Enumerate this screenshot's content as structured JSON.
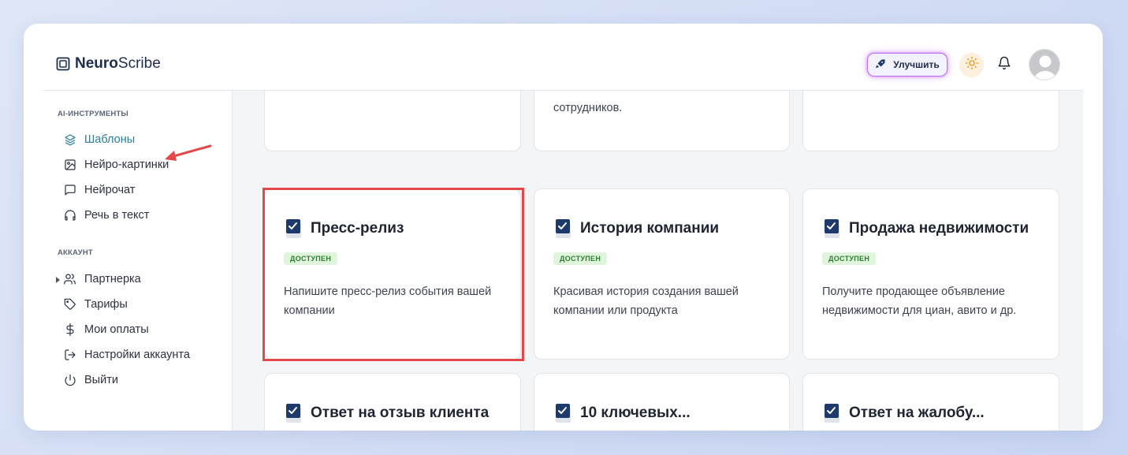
{
  "app": {
    "logo_bold": "Neuro",
    "logo_regular": "Scribe"
  },
  "header": {
    "upgrade_label": "Улучшить",
    "icons": [
      "rocket-icon",
      "sun-icon",
      "bell-icon",
      "avatar"
    ]
  },
  "sidebar": {
    "sections": [
      {
        "title": "AI-ИНСТРУМЕНТЫ",
        "items": [
          {
            "label": "Шаблоны",
            "icon": "layers-icon",
            "active": true
          },
          {
            "label": "Нейро-картинки",
            "icon": "image-icon"
          },
          {
            "label": "Нейрочат",
            "icon": "chat-icon"
          },
          {
            "label": "Речь в текст",
            "icon": "headphones-icon"
          }
        ]
      },
      {
        "title": "АККАУНТ",
        "items": [
          {
            "label": "Партнерка",
            "icon": "users-icon",
            "expandable": true
          },
          {
            "label": "Тарифы",
            "icon": "tag-icon"
          },
          {
            "label": "Мои оплаты",
            "icon": "dollar-icon"
          },
          {
            "label": "Настройки аккаунта",
            "icon": "logout-box-icon"
          },
          {
            "label": "Выйти",
            "icon": "power-icon"
          }
        ]
      }
    ]
  },
  "cards": {
    "top_row": [
      {
        "text": ""
      },
      {
        "text": "сотрудников."
      },
      {
        "text": ""
      }
    ],
    "middle_row": [
      {
        "title": "Пресс-релиз",
        "badge": "ДОСТУПЕН",
        "desc": "Напишите пресс-релиз события вашей компании"
      },
      {
        "title": "История компании",
        "badge": "ДОСТУПЕН",
        "desc": "Красивая история создания вашей компании или продукта"
      },
      {
        "title": "Продажа недвижимости",
        "badge": "ДОСТУПЕН",
        "desc": "Получите продающее объявление недвижимости для циан, авито и др."
      }
    ],
    "bottom_row": [
      {
        "title": "Ответ на отзыв клиента"
      },
      {
        "title": "10 ключевых..."
      },
      {
        "title": "Ответ на жалобу..."
      }
    ]
  },
  "colors": {
    "accent": "#2f7e98",
    "highlight": "#e44848",
    "badge_bg": "#dff5dc",
    "badge_text": "#2e7d32",
    "icon_navy": "#1d3a6b"
  }
}
